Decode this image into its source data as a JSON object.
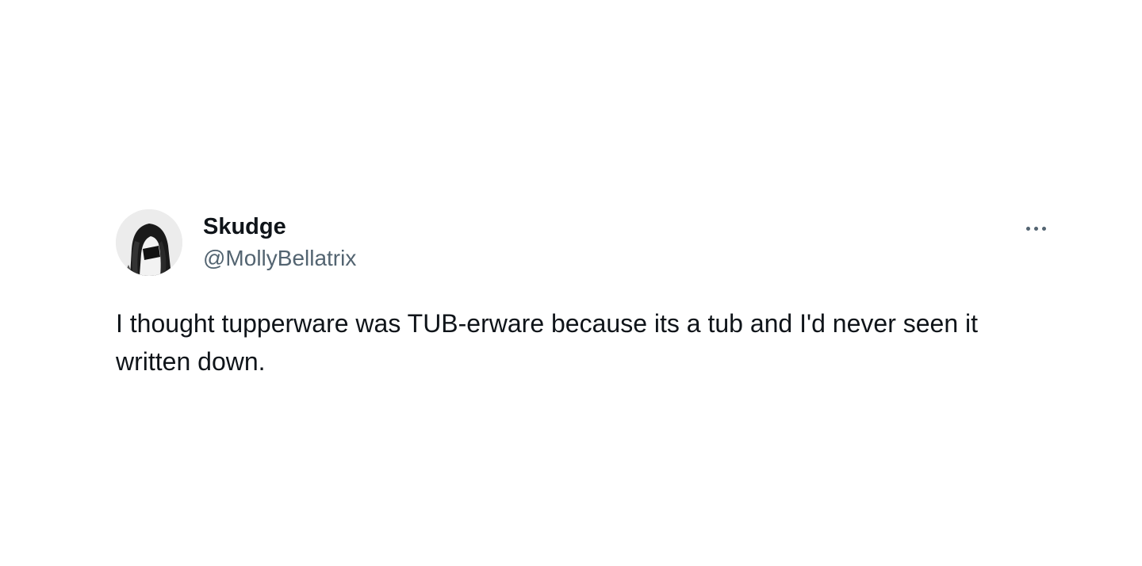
{
  "tweet": {
    "author": {
      "display_name": "Skudge",
      "handle": "@MollyBellatrix",
      "avatar_icon": "avatar-photo"
    },
    "more_icon": "more-horizontal-icon",
    "text": "I thought tupperware was TUB-erware because its a tub and I'd never seen it written down."
  },
  "colors": {
    "background": "#ffffff",
    "primary_text": "#0f1419",
    "secondary_text": "#536471"
  }
}
